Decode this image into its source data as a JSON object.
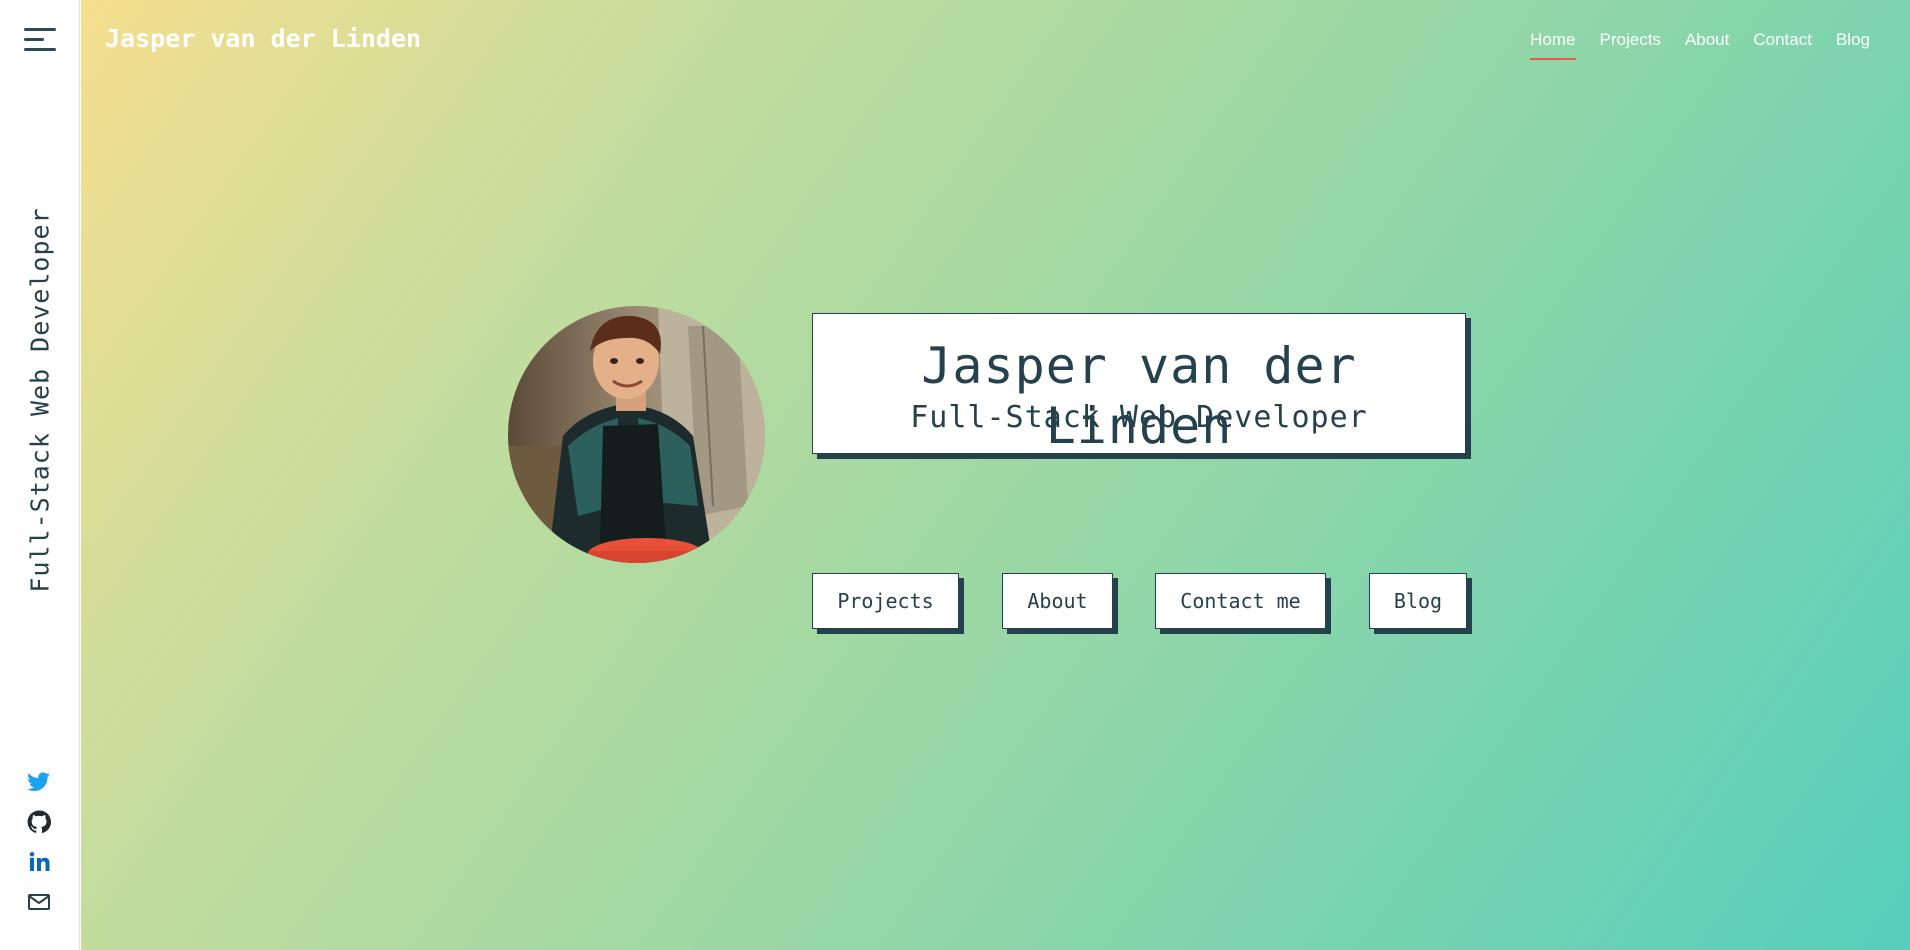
{
  "sidebar": {
    "tagline": "Full-Stack Web Developer",
    "social": [
      {
        "icon": "twitter-icon",
        "color": "#1da1f2"
      },
      {
        "icon": "github-icon",
        "color": "#24292e"
      },
      {
        "icon": "linkedin-icon",
        "color": "#0a66c2"
      },
      {
        "icon": "mail-icon",
        "color": "#24414d"
      }
    ]
  },
  "header": {
    "brand": "Jasper van der Linden",
    "nav": [
      {
        "label": "Home",
        "active": true
      },
      {
        "label": "Projects",
        "active": false
      },
      {
        "label": "About",
        "active": false
      },
      {
        "label": "Contact",
        "active": false
      },
      {
        "label": "Blog",
        "active": false
      }
    ]
  },
  "hero": {
    "name": "Jasper van der Linden",
    "role": "Full-Stack Web Developer",
    "buttons": [
      {
        "label": "Projects"
      },
      {
        "label": "About"
      },
      {
        "label": "Contact me"
      },
      {
        "label": "Blog"
      }
    ]
  },
  "colors": {
    "accent": "#ef5b46",
    "text": "#24414d",
    "gradient_start": "#f6de8e",
    "gradient_end": "#56cfbc"
  }
}
